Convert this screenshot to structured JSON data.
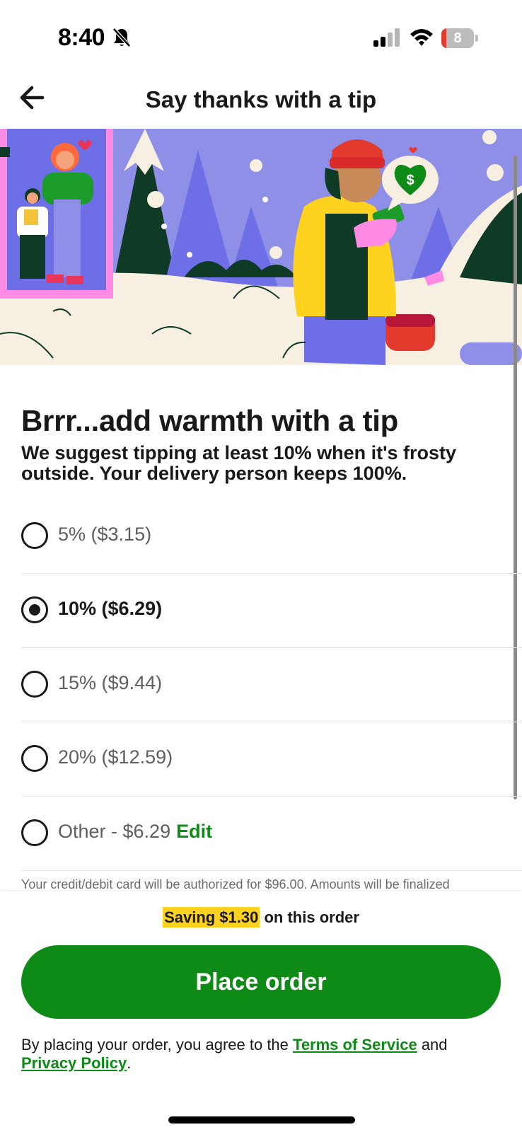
{
  "status_bar": {
    "time": "8:40",
    "battery_level": "8",
    "battery_fraction": 0.15
  },
  "header": {
    "title": "Say thanks with a tip",
    "back_icon": "arrow-left-icon"
  },
  "content": {
    "headline": "Brrr...add warmth with a tip",
    "subtext": "We suggest tipping at least 10% when it's frosty outside. Your delivery person keeps 100%."
  },
  "tip_options": [
    {
      "label": "5% ($3.15)",
      "selected": false
    },
    {
      "label": "10% ($6.29)",
      "selected": true
    },
    {
      "label": "15% ($9.44)",
      "selected": false
    },
    {
      "label": "20% ($12.59)",
      "selected": false
    },
    {
      "label": "Other - $6.29",
      "selected": false,
      "action": "Edit"
    }
  ],
  "auth_note": "Your credit/debit card will be authorized for $96.00. Amounts will be finalized",
  "footer": {
    "saving_badge": "Saving $1.30",
    "saving_suffix": " on this order",
    "place_order": "Place order",
    "legal_prefix": "By placing your order, you agree to the ",
    "terms": "Terms of Service",
    "legal_and": " and",
    "privacy": "Privacy Policy",
    "legal_end": "."
  },
  "colors": {
    "accent_green": "#0e8a16",
    "saving_yellow": "#ffd21f",
    "text": "#191919"
  }
}
